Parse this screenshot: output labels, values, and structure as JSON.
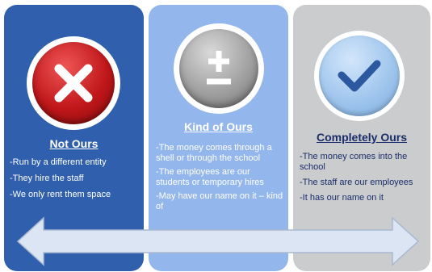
{
  "columns": [
    {
      "title": "Not Ours",
      "icon": "x-icon",
      "color": "#2f5fad",
      "items": [
        "-Run by a different entity",
        "-They hire the staff",
        "-We only rent them space"
      ]
    },
    {
      "title": "Kind of Ours",
      "icon": "plus-minus-icon",
      "color": "#93b6ec",
      "items": [
        "-The money comes through a shell or through the school",
        "-The employees are our students or temporary hires",
        "-May have our name on it – kind of"
      ]
    },
    {
      "title": "Completely Ours",
      "icon": "check-icon",
      "color": "#cbcccd",
      "items": [
        "-The money comes into the school",
        "-The staff are our employees",
        "-It has our name on it"
      ]
    }
  ],
  "arrow": {
    "icon": "double-arrow-icon",
    "color": "#dbe5f4"
  }
}
